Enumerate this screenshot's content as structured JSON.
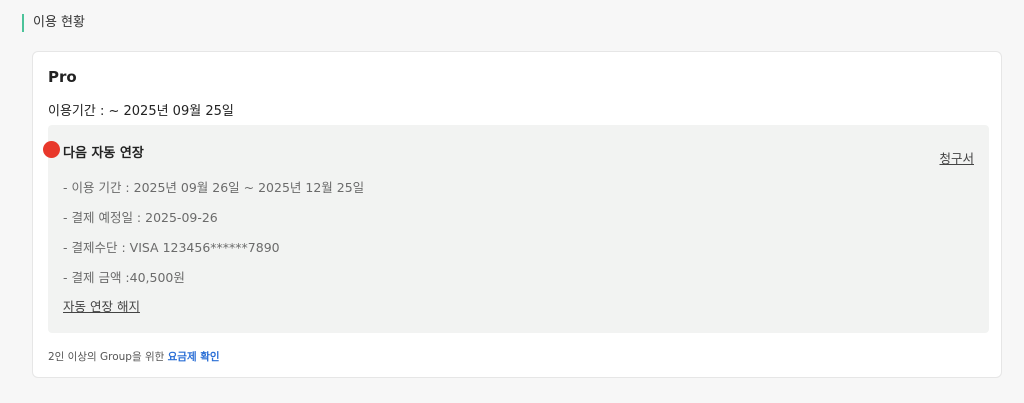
{
  "section": {
    "title": "이용 현황"
  },
  "plan": {
    "name": "Pro",
    "period_text": "이용기간 : ~ 2025년 09월 25일"
  },
  "renewal": {
    "title": "다음 자동 연장",
    "invoice_label": "청구서",
    "details": {
      "usage_period": "- 이용 기간 : 2025년 09월 26일 ~ 2025년 12월 25일",
      "payment_date": "- 결제 예정일 : 2025-09-26",
      "payment_method": "- 결제수단 : VISA 123456******7890",
      "payment_amount": "- 결제 금액 :40,500원"
    },
    "cancel_label": "자동 연장 해지"
  },
  "footer": {
    "note_text": "2인 이상의 Group을 위한 ",
    "pricing_link": "요금제 확인"
  },
  "colors": {
    "accent_bar": "#4cc39a",
    "marker": "#e8382b",
    "link_blue": "#2b6fd6"
  }
}
